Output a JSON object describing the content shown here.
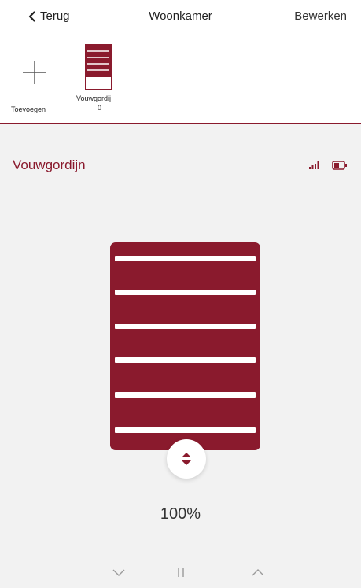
{
  "nav": {
    "back_label": "Terug",
    "title": "Woonkamer",
    "edit_label": "Bewerken",
    "back_icon": "chevron-left-icon"
  },
  "devices": {
    "add_label": "Toevoegen",
    "add_icon": "plus-icon",
    "items": [
      {
        "label": "Vouwgordij",
        "sub": "0",
        "icon": "folding-blind-icon"
      }
    ]
  },
  "device": {
    "name": "Vouwgordijn",
    "signal_icon": "signal-icon",
    "battery_icon": "battery-icon",
    "position_percent": 100,
    "position_label": "100%",
    "handle_icon": "up-down-arrows-icon"
  },
  "controls": {
    "down_icon": "chevron-down-icon",
    "stop_icon": "pause-icon",
    "up_icon": "chevron-up-icon"
  },
  "colors": {
    "accent": "#8a1a2d",
    "panel_bg": "#f2f2f2",
    "control_gray": "#9a9a9a"
  }
}
